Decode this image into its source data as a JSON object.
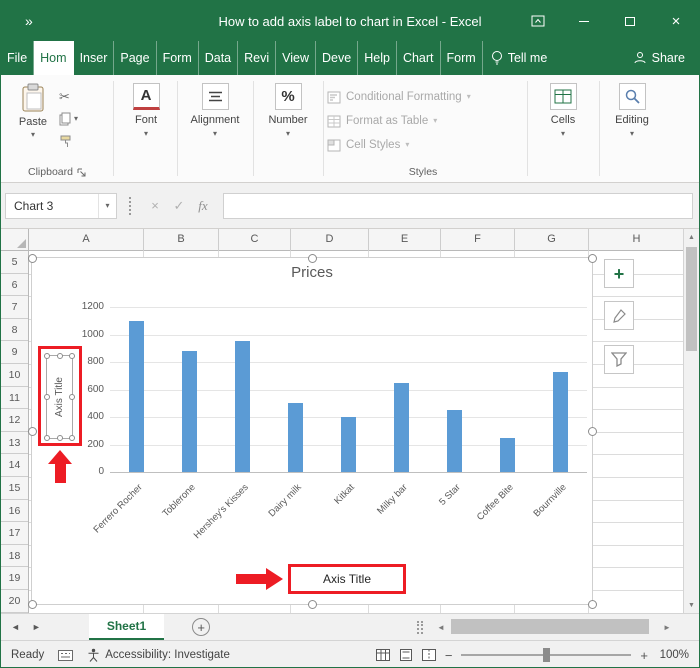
{
  "titlebar": {
    "title": "How to add axis label to chart in Excel - Excel"
  },
  "tabs": [
    {
      "label": "File",
      "active": false
    },
    {
      "label": "Hom",
      "active": true
    },
    {
      "label": "Inser",
      "active": false
    },
    {
      "label": "Page",
      "active": false
    },
    {
      "label": "Form",
      "active": false
    },
    {
      "label": "Data",
      "active": false
    },
    {
      "label": "Revi",
      "active": false
    },
    {
      "label": "View",
      "active": false
    },
    {
      "label": "Deve",
      "active": false
    },
    {
      "label": "Help",
      "active": false
    },
    {
      "label": "Chart",
      "active": false
    },
    {
      "label": "Form",
      "active": false
    }
  ],
  "tell_me": "Tell me",
  "share": "Share",
  "ribbon": {
    "paste": "Paste",
    "clipboard_group": "Clipboard",
    "font_group": "Font",
    "alignment_group": "Alignment",
    "number_group": "Number",
    "styles": [
      "Conditional Formatting",
      "Format as Table",
      "Cell Styles"
    ],
    "styles_group": "Styles",
    "cells_group": "Cells",
    "editing_group": "Editing"
  },
  "formula_bar": {
    "name_box": "Chart 3",
    "cancel": "×",
    "enter": "✓",
    "fx": "fx"
  },
  "sheet": {
    "columns": [
      "A",
      "B",
      "C",
      "D",
      "E",
      "F",
      "G",
      "H"
    ],
    "rows": [
      "5",
      "6",
      "7",
      "8",
      "9",
      "10",
      "11",
      "12",
      "13",
      "14",
      "15",
      "16",
      "17",
      "18",
      "19",
      "20"
    ],
    "active_tab": "Sheet1"
  },
  "chart_data": {
    "type": "bar",
    "title": "Prices",
    "categories": [
      "Ferrero Rocher",
      "Toblerone",
      "Hershey's Kisses",
      "Dairy milk",
      "Kitkat",
      "Milky bar",
      "5 Star",
      "Coffee Bite",
      "Bournville"
    ],
    "values": [
      1100,
      880,
      950,
      500,
      400,
      650,
      450,
      250,
      730
    ],
    "ylim": [
      0,
      1200
    ],
    "yticks": [
      0,
      200,
      400,
      600,
      800,
      1000,
      1200
    ],
    "bar_color": "#5b9bd5",
    "left_axis_title": "Axis Title",
    "bottom_axis_title": "Axis Title",
    "legend": "none",
    "grid": true
  },
  "status_bar": {
    "mode": "Ready",
    "accessibility": "Accessibility: Investigate",
    "zoom": "100%"
  },
  "colors": {
    "excel_green": "#217346",
    "bar_blue": "#5b9bd5",
    "annotation_red": "#ed1c24"
  }
}
